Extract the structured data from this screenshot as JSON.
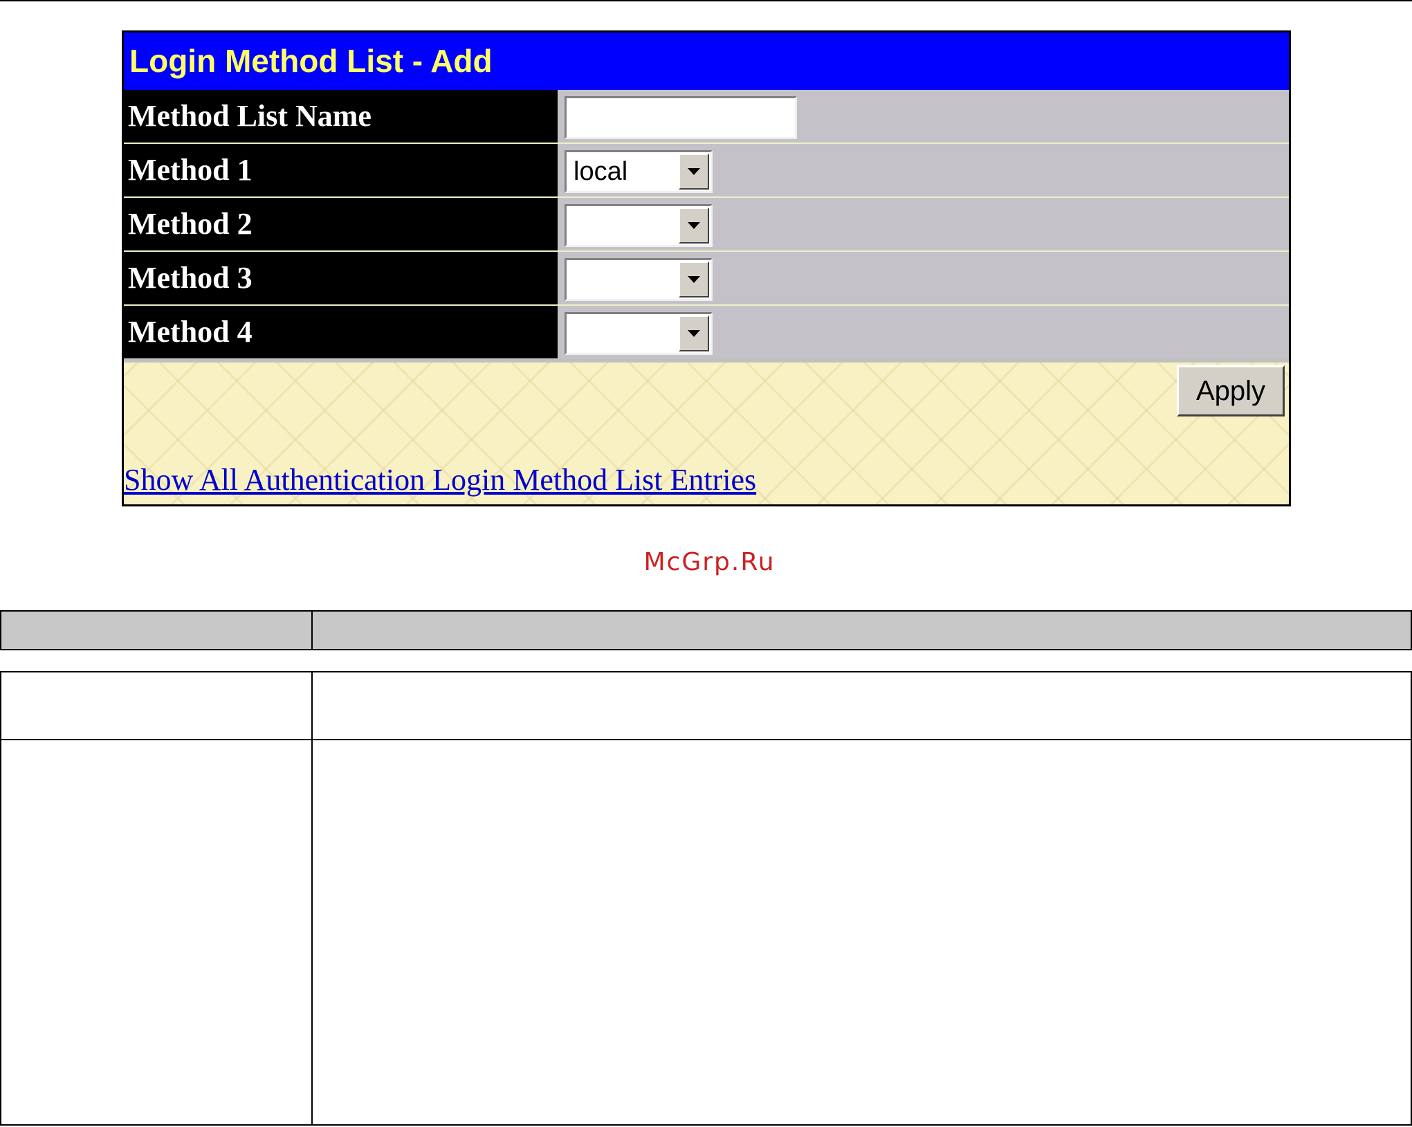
{
  "panel": {
    "title": "Login Method List - Add",
    "rows": [
      {
        "label": "Method List Name",
        "kind": "text",
        "value": ""
      },
      {
        "label": "Method 1",
        "kind": "select",
        "value": "local"
      },
      {
        "label": "Method 2",
        "kind": "select",
        "value": ""
      },
      {
        "label": "Method 3",
        "kind": "select",
        "value": ""
      },
      {
        "label": "Method 4",
        "kind": "select",
        "value": ""
      }
    ],
    "apply_label": "Apply",
    "show_all_link": "Show All Authentication Login Method List Entries"
  },
  "watermark": "McGrp.Ru",
  "table": {
    "header": [
      "",
      ""
    ],
    "rows": [
      [
        "",
        ""
      ],
      [
        "",
        ""
      ]
    ]
  },
  "colors": {
    "title_bar": "#0000ff",
    "title_text": "#ffff66",
    "label_bg": "#000000",
    "value_bg": "#c4c2c8",
    "footer_bg": "#f8f1c4",
    "link": "#0000cc",
    "watermark": "#cc2222"
  }
}
